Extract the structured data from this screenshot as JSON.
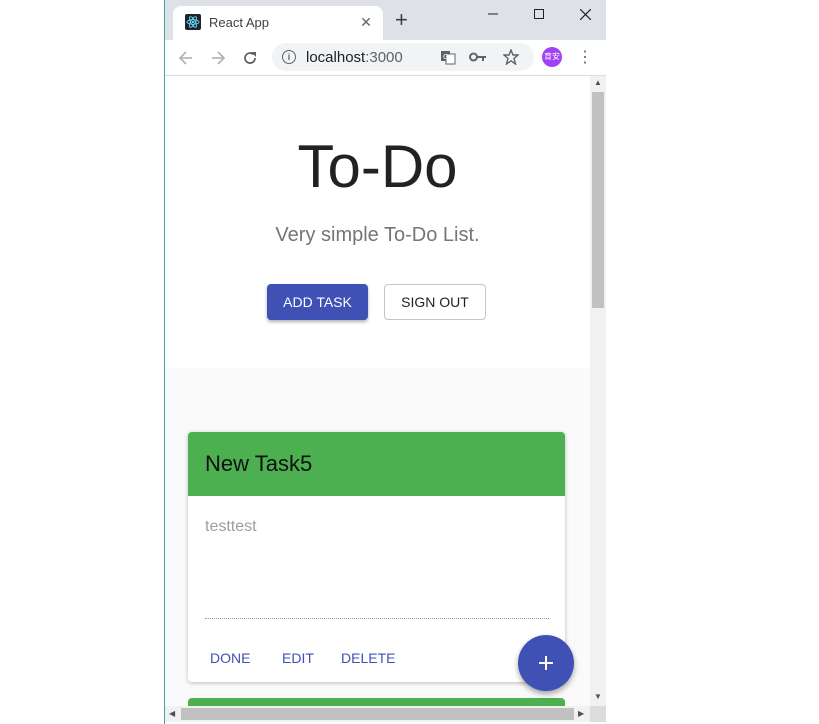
{
  "browser": {
    "tab_title": "React App",
    "url_host": "localhost",
    "url_port": ":3000",
    "avatar_text": "育安",
    "icons": [
      "react-favicon",
      "close-icon",
      "plus-icon",
      "minimize-icon",
      "maximize-icon",
      "close-window-icon",
      "back-icon",
      "forward-icon",
      "reload-icon",
      "info-icon",
      "translate-icon",
      "key-icon",
      "star-icon",
      "kebab-menu-icon"
    ]
  },
  "page": {
    "title": "To-Do",
    "subtitle": "Very simple To-Do List.",
    "add_task_label": "ADD TASK",
    "sign_out_label": "SIGN OUT"
  },
  "tasks": [
    {
      "title": "New Task5",
      "description": "testtest",
      "actions": [
        "DONE",
        "EDIT",
        "DELETE"
      ]
    }
  ],
  "fab_icon": "plus-icon",
  "colors": {
    "primary": "#3f51b5",
    "card_header": "#4caf50"
  }
}
